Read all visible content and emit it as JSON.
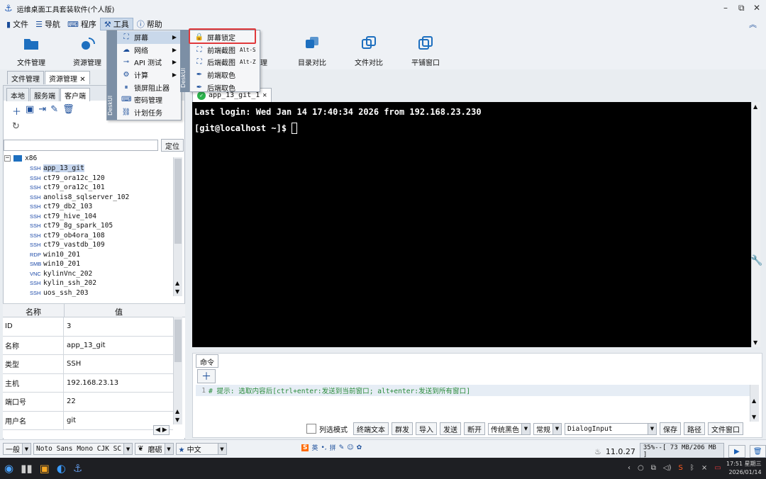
{
  "app": {
    "title": "运维桌面工具套装软件(个人版)"
  },
  "menubar": {
    "file": "文件",
    "nav": "导航",
    "program": "程序",
    "tools": "工具",
    "help": "帮助"
  },
  "toolbar": {
    "file_mgr": "文件管理",
    "res_mgr": "资源管理",
    "mgr_partial": "理",
    "dir_compare": "目录对比",
    "file_compare": "文件对比",
    "tile": "平铺窗口"
  },
  "left": {
    "tabs": [
      "文件管理",
      "资源管理"
    ],
    "subtabs": [
      "本地",
      "服务端",
      "客户端"
    ],
    "locate": "定位",
    "folder": "x86",
    "items": [
      {
        "p": "SSH",
        "n": "app_13_git"
      },
      {
        "p": "SSH",
        "n": "ct79_ora12c_120"
      },
      {
        "p": "SSH",
        "n": "ct79_ora12c_101"
      },
      {
        "p": "SSH",
        "n": "anolis8_sqlserver_102"
      },
      {
        "p": "SSH",
        "n": "ct79_db2_103"
      },
      {
        "p": "SSH",
        "n": "ct79_hive_104"
      },
      {
        "p": "SSH",
        "n": "ct79_8g_spark_105"
      },
      {
        "p": "SSH",
        "n": "ct79_ob4ora_108"
      },
      {
        "p": "SSH",
        "n": "ct79_vastdb_109"
      },
      {
        "p": "RDP",
        "n": "win10_201"
      },
      {
        "p": "SMB",
        "n": "win10_201"
      },
      {
        "p": "VNC",
        "n": "kylinVnc_202"
      },
      {
        "p": "SSH",
        "n": "kylin_ssh_202"
      },
      {
        "p": "SSH",
        "n": "uos_ssh_203"
      }
    ],
    "props_header": {
      "k": "名称",
      "v": "值"
    },
    "props": [
      {
        "k": "ID",
        "v": "3"
      },
      {
        "k": "名称",
        "v": "app_13_git"
      },
      {
        "k": "类型",
        "v": "SSH"
      },
      {
        "k": "主机",
        "v": "192.168.23.13"
      },
      {
        "k": "端口号",
        "v": "22"
      },
      {
        "k": "用户名",
        "v": "git"
      }
    ]
  },
  "tools_menu": {
    "items": [
      "屏幕",
      "网络",
      "API 测试",
      "计算",
      "锁屏阻止器",
      "密码管理",
      "计划任务"
    ],
    "deskui": "DeskUI"
  },
  "screen_submenu": {
    "items": [
      {
        "l": "屏幕锁定",
        "s": ""
      },
      {
        "l": "前端截图",
        "s": "Alt-S"
      },
      {
        "l": "后端截图",
        "s": "Alt-Z"
      },
      {
        "l": "前端取色",
        "s": ""
      },
      {
        "l": "后端取色",
        "s": ""
      }
    ]
  },
  "terminal": {
    "tab": "app_13_git_1",
    "line1": "Last login: Wed Jan 14 17:40:34 2026 from 192.168.23.230",
    "prompt": "[git@localhost ~]$ "
  },
  "cmd": {
    "tab": "命令",
    "hint": "# 提示: 选取内容后[ctrl+enter:发送到当前窗口; alt+enter:发送到所有窗口]",
    "line_no": "1"
  },
  "cmdbar": {
    "select_mode": "列选模式",
    "wrap": "终端文本",
    "group": "群发",
    "import": "导入",
    "send": "发送",
    "disconnect": "断开",
    "theme": "传统黑色",
    "mode": "常规",
    "input": "DialogInput",
    "save": "保存",
    "path": "路径",
    "file_window": "文件窗口"
  },
  "status": {
    "general": "一般",
    "font": "Noto Sans Mono CJK SC",
    "style": "磨砺",
    "lang": "中文",
    "ime": "英",
    "version": "11.0.27",
    "mem": "35%--[ 73 MB/206 MB ]"
  },
  "taskbar": {
    "time": "17:51 星期三",
    "date": "2026/01/14"
  },
  "colors": {
    "highlight": "#e0393b",
    "terminal_bg": "#000000"
  }
}
